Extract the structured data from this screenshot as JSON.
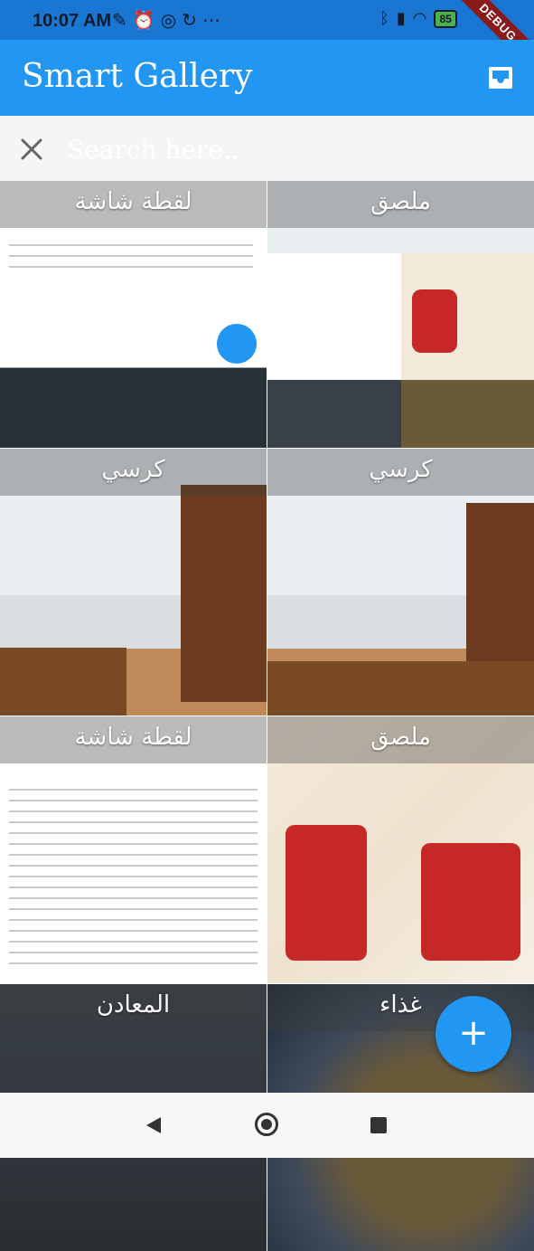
{
  "status_bar": {
    "time": "10:07 AM",
    "left_icons": [
      "notifications-off-icon",
      "alarm-icon",
      "whatsapp-icon",
      "refresh-icon",
      "more-icon"
    ],
    "right_icons": [
      "bluetooth-icon",
      "signal-icon",
      "wifi-icon"
    ],
    "battery": "85",
    "debug_banner": "DEBUG"
  },
  "app_bar": {
    "title": "Smart Gallery",
    "action_icon": "inbox-icon"
  },
  "search": {
    "placeholder": "Search here..",
    "value": ""
  },
  "grid": {
    "tiles": [
      {
        "label": "لقطة شاشة",
        "image": "screenshot"
      },
      {
        "label": "ملصق",
        "image": "collage"
      },
      {
        "label": "كرسي",
        "image": "room"
      },
      {
        "label": "كرسي",
        "image": "room"
      },
      {
        "label": "لقطة شاشة",
        "image": "document"
      },
      {
        "label": "ملصق",
        "image": "poster"
      },
      {
        "label": "المعادن",
        "image": "metal"
      },
      {
        "label": "غذاء",
        "image": "food"
      }
    ]
  },
  "fab": {
    "icon": "add-icon",
    "label": "+"
  },
  "nav": {
    "icons": [
      "back-icon",
      "home-icon",
      "recents-icon"
    ]
  },
  "colors": {
    "primary": "#2196f3",
    "status_bar": "#1976d2"
  }
}
